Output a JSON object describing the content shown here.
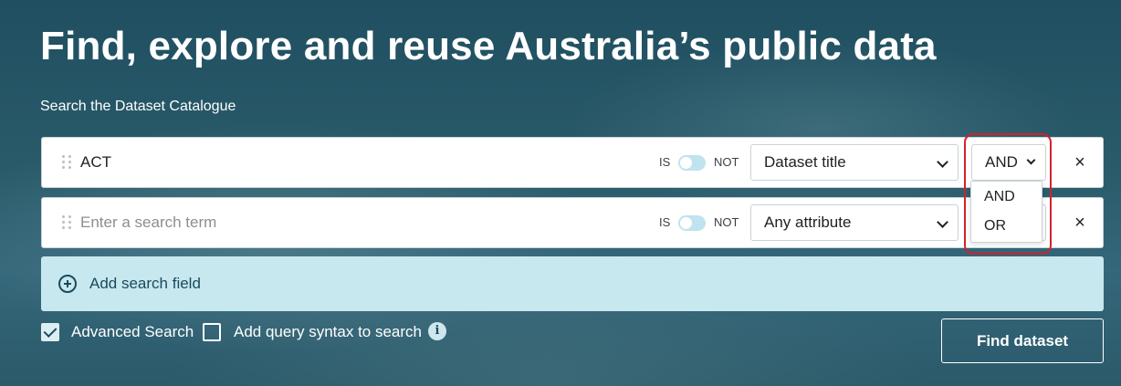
{
  "hero": {
    "title": "Find, explore and reuse Australia’s public data",
    "subtitle": "Search the Dataset Catalogue"
  },
  "rows": [
    {
      "term_value": "ACT",
      "term_placeholder": "",
      "is_label": "IS",
      "not_label": "NOT",
      "attribute": "Dataset title",
      "operator": "AND",
      "close_icon": "×"
    },
    {
      "term_value": "",
      "term_placeholder": "Enter a search term",
      "is_label": "IS",
      "not_label": "NOT",
      "attribute": "Any attribute",
      "close_icon": "×"
    }
  ],
  "operator_dropdown": {
    "options": [
      "AND",
      "OR"
    ]
  },
  "add_field": {
    "label": "Add search field"
  },
  "options": {
    "advanced_search": "Advanced Search",
    "advanced_search_checked": true,
    "query_syntax": "Add query syntax to search",
    "query_syntax_checked": false,
    "info_icon": "i"
  },
  "find_button": "Find dataset",
  "colors": {
    "background": "#1d4d5e",
    "add_bar": "#c8e8f0",
    "highlight": "#d1222b",
    "toggle": "#bfe3ef"
  }
}
